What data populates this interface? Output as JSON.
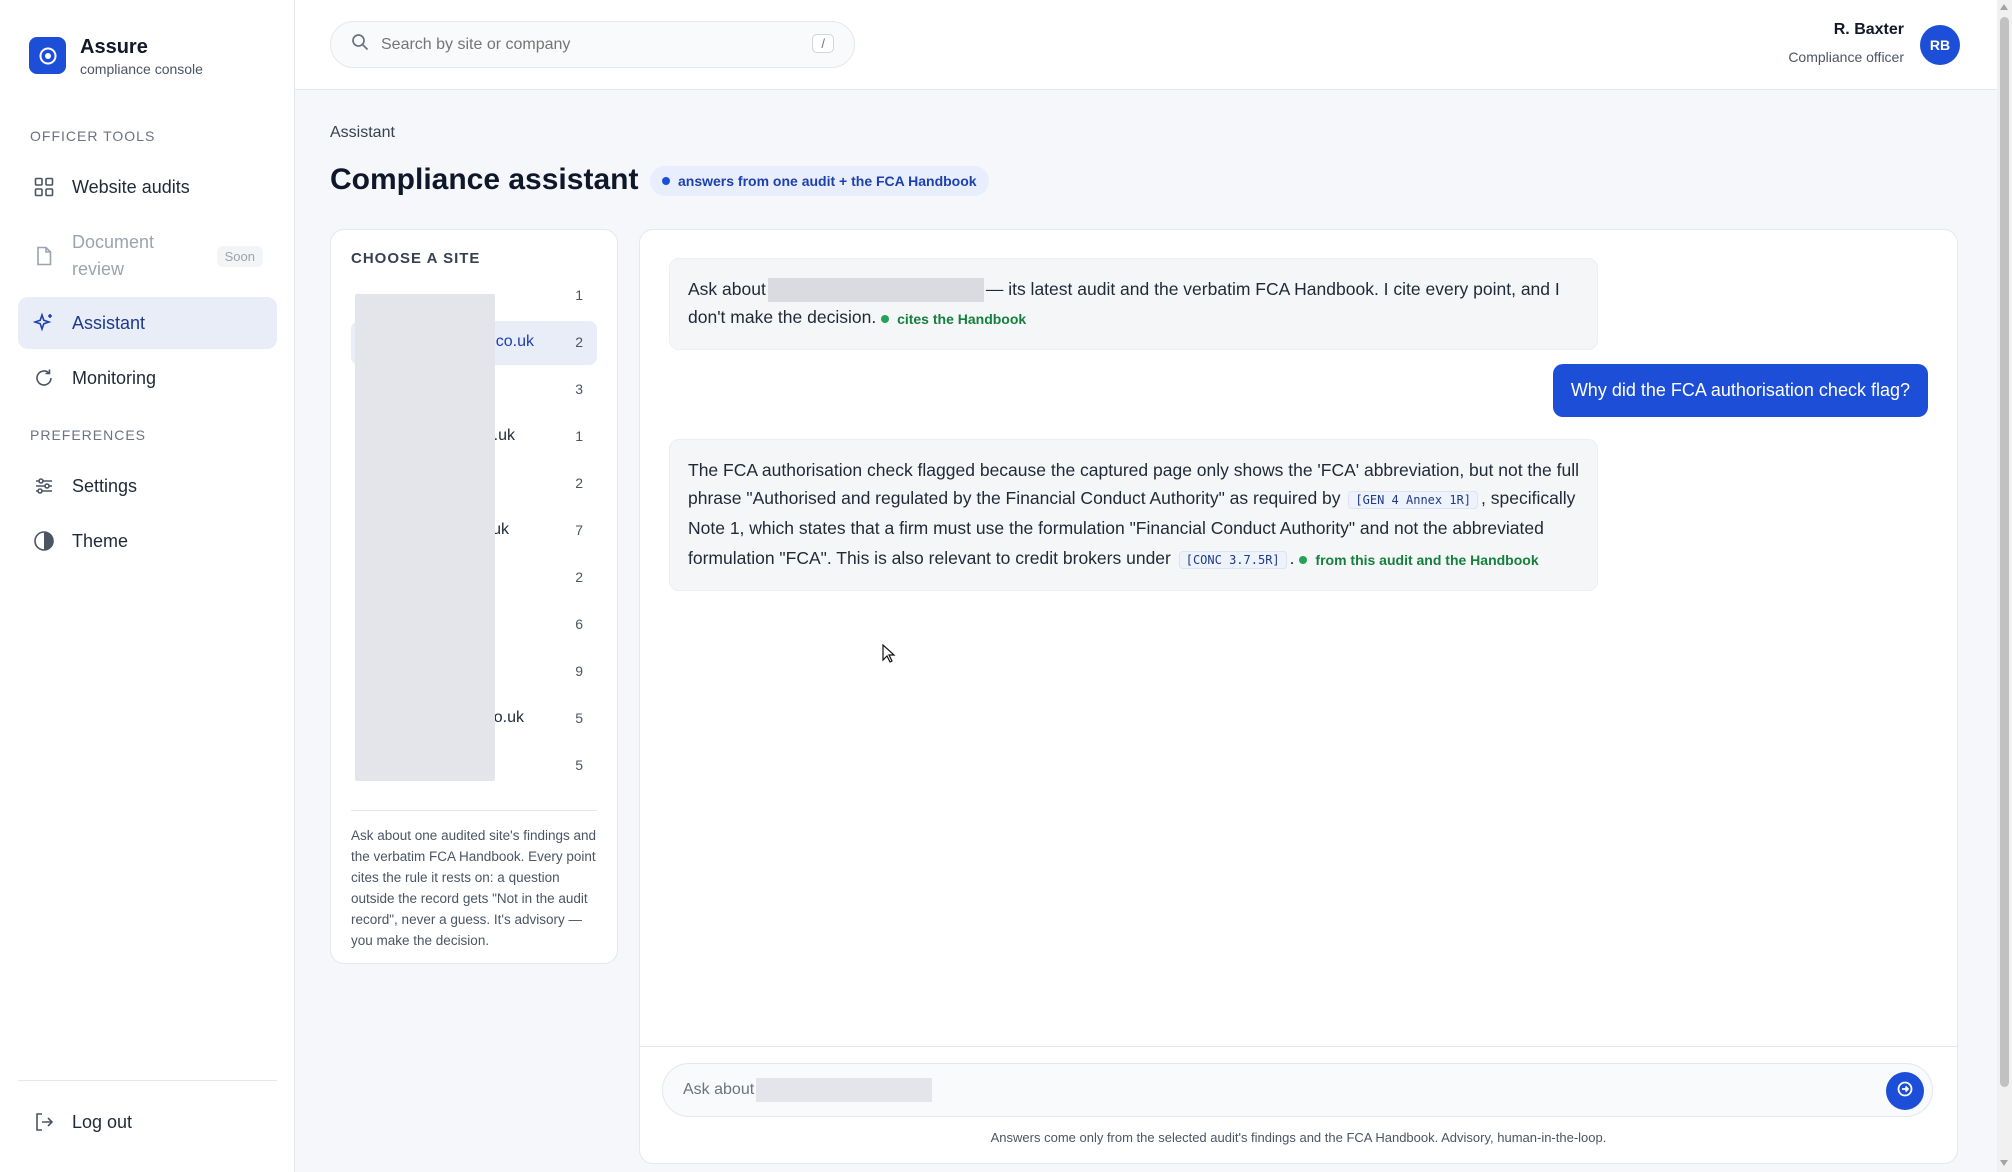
{
  "brand": {
    "name": "Assure",
    "subtitle": "compliance console",
    "accent": "#1d4ed8"
  },
  "sidebar": {
    "sections": {
      "tools": "OFFICER TOOLS",
      "preferences": "PREFERENCES"
    },
    "items": [
      {
        "label": "Website audits",
        "icon": "grid-icon"
      },
      {
        "label": "Document review",
        "icon": "document-icon",
        "badge": "Soon"
      },
      {
        "label": "Assistant",
        "icon": "sparkle-icon",
        "active": true
      },
      {
        "label": "Monitoring",
        "icon": "refresh-icon"
      },
      {
        "label": "Settings",
        "icon": "sliders-icon"
      },
      {
        "label": "Theme",
        "icon": "contrast-icon"
      }
    ],
    "logout": "Log out"
  },
  "topbar": {
    "search_placeholder": "Search by site or company",
    "search_shortcut": "/",
    "user_name": "R. Baxter",
    "user_role": "Compliance officer",
    "user_initials": "RB"
  },
  "page": {
    "breadcrumb": "Assistant",
    "title": "Compliance assistant",
    "scope_badge": "answers from one audit + the FCA Handbook"
  },
  "sites": {
    "title": "CHOOSE A SITE",
    "items": [
      {
        "name": "",
        "count": "1"
      },
      {
        "name": ".co.uk",
        "count": "2",
        "selected": true
      },
      {
        "name": "",
        "count": "3"
      },
      {
        "name": "o.uk",
        "count": "1"
      },
      {
        "name": "",
        "count": "2"
      },
      {
        "name": "uk",
        "count": "7"
      },
      {
        "name": "",
        "count": "2"
      },
      {
        "name": "",
        "count": "6"
      },
      {
        "name": "",
        "count": "9"
      },
      {
        "name": "co.uk",
        "count": "5"
      },
      {
        "name": "",
        "count": "5"
      }
    ],
    "note": "Ask about one audited site's findings and the verbatim FCA Handbook. Every point cites the rule it rests on: a question outside the record gets \"Not in the audit record\", never a guess. It's advisory — you make the decision."
  },
  "chat": {
    "intro": {
      "lead": "Ask about",
      "body": "— its latest audit and the verbatim FCA Handbook. I cite every point, and I don't make the decision.",
      "tag": "cites the Handbook"
    },
    "question": "Why did the FCA authorisation check flag?",
    "answer": {
      "part1": "The FCA authorisation check flagged because the captured page only shows the 'FCA' abbreviation, but not the full phrase \"Authorised and regulated by the Financial Conduct Authority\" as required by",
      "ref1": "[GEN 4 Annex 1R]",
      "part2": ", specifically Note 1, which states that a firm must use the formulation \"Financial Conduct Authority\" and not the abbreviated formulation \"FCA\". This is also relevant to credit brokers under",
      "ref2": "[CONC 3.7.5R]",
      "part3": ".",
      "tag": "from this audit and the Handbook"
    },
    "composer_placeholder": "Ask about",
    "footer": "Answers come only from the selected audit's findings and the FCA Handbook. Advisory, human-in-the-loop."
  }
}
